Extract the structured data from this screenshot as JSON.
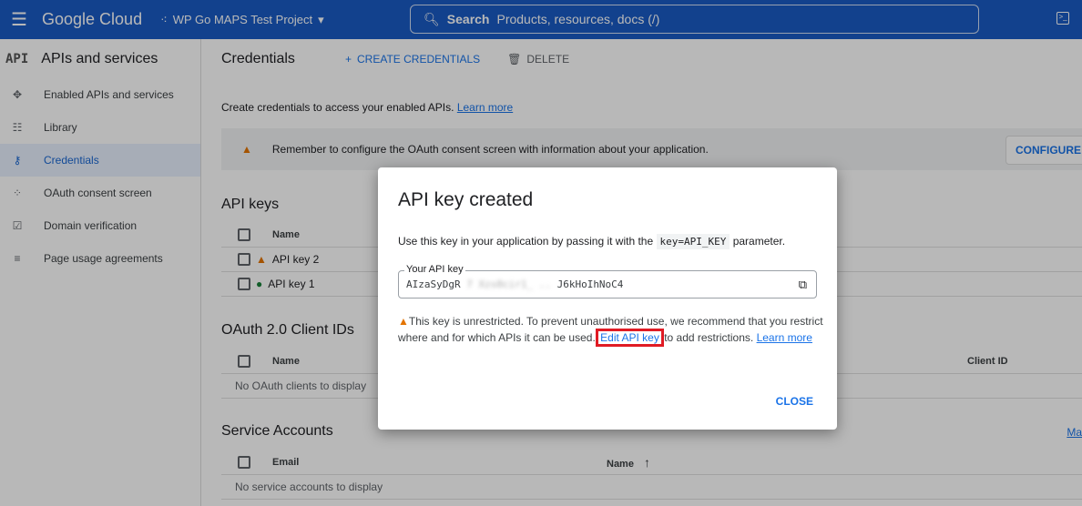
{
  "header": {
    "brand": "Google Cloud",
    "project": "WP Go MAPS Test Project",
    "search_label": "Search",
    "search_placeholder": "Products, resources, docs (/)"
  },
  "sidebar": {
    "title": "APIs and services",
    "api_badge": "API",
    "items": [
      {
        "label": "Enabled APIs and services",
        "icon": "move-icon"
      },
      {
        "label": "Library",
        "icon": "library-icon"
      },
      {
        "label": "Credentials",
        "icon": "key-icon",
        "active": true
      },
      {
        "label": "OAuth consent screen",
        "icon": "dots-icon"
      },
      {
        "label": "Domain verification",
        "icon": "checkbox-icon"
      },
      {
        "label": "Page usage agreements",
        "icon": "settings-list-icon"
      }
    ]
  },
  "main": {
    "title": "Credentials",
    "create": "CREATE CREDENTIALS",
    "delete": "DELETE",
    "intro": "Create credentials to access your enabled APIs.",
    "learn_more": "Learn more",
    "banner": "Remember to configure the OAuth consent screen with information about your application.",
    "configure": "CONFIGURE",
    "api_keys": {
      "title": "API keys",
      "col_name": "Name",
      "rows": [
        "API key 2",
        "API key 1"
      ]
    },
    "oauth": {
      "title": "OAuth 2.0 Client IDs",
      "col_name": "Name",
      "col_client": "Client ID",
      "empty": "No OAuth clients to display"
    },
    "service": {
      "title": "Service Accounts",
      "col_email": "Email",
      "col_name": "Name",
      "manage": "Ma",
      "empty": "No service accounts to display"
    }
  },
  "dialog": {
    "title": "API key created",
    "text_before": "Use this key in your application by passing it with the",
    "code": "key=API_KEY",
    "text_after": "parameter.",
    "field_label": "Your API key",
    "key_start": "AIzaSyDgR",
    "key_hidden": "7  Xzs0cir1_ ..",
    "key_end": "J6kHoIhNoC4",
    "warning_1": "This key is unrestricted. To prevent unauthorised use, we recommend that you restrict where and for which APIs it can be used",
    "edit_link": "Edit API key",
    "warning_2": "to add restrictions.",
    "learn_more": "Learn more",
    "close": "CLOSE"
  }
}
